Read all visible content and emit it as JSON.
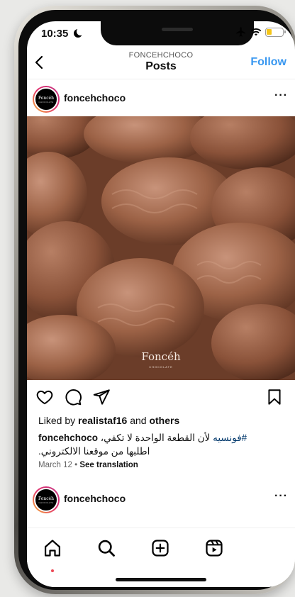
{
  "status": {
    "time": "10:35"
  },
  "header": {
    "subtitle": "FONCEHCHOCO",
    "title": "Posts",
    "follow_label": "Follow"
  },
  "post": {
    "username": "foncehchoco",
    "more_label": "···",
    "image_brand": "Foncéh",
    "image_brand_sub": "CHOCOLATE",
    "likes": {
      "prefix": "Liked by ",
      "user": "realistaf16",
      "middle": " and ",
      "others": "others"
    },
    "caption": {
      "user": "foncehchoco",
      "hashtag": "#فونسيه",
      "text_line1": " لأن القطعة الواحدة لا تكفي،",
      "text_line2": "اطلبها من موقعنا الالكتروني."
    },
    "date": "March 12",
    "separator": " • ",
    "see_translation": "See translation"
  },
  "next_post": {
    "username": "foncehchoco",
    "more_label": "···"
  },
  "colors": {
    "accent": "#3897f0",
    "hashtag": "#00376b",
    "notification_dot": "#ed4956"
  },
  "icons": {
    "back": "chevron-left-icon",
    "like": "heart-icon",
    "comment": "comment-icon",
    "share": "send-icon",
    "save": "bookmark-icon",
    "tabs": [
      "home-icon",
      "search-icon",
      "add-icon",
      "reels-icon"
    ]
  }
}
